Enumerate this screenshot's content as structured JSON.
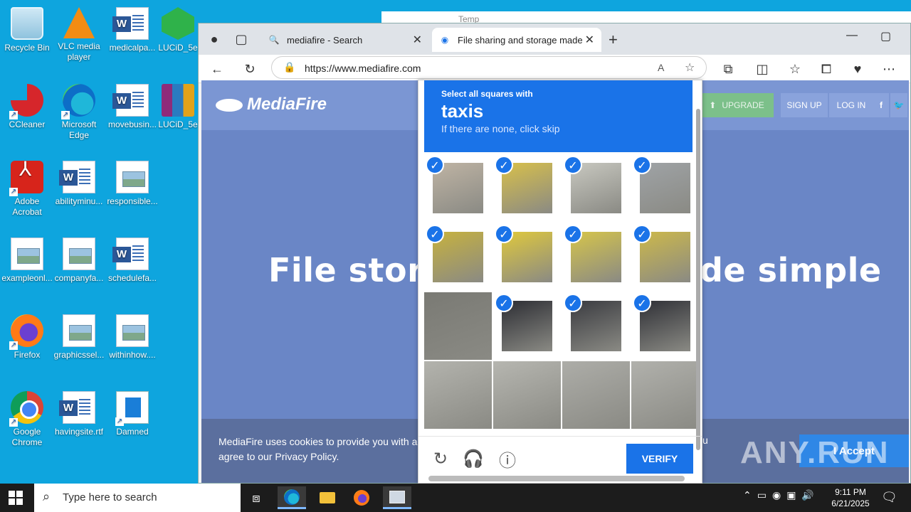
{
  "desktop": {
    "icons": [
      {
        "label": "Recycle Bin",
        "icon": "recycle-bin-icon"
      },
      {
        "label": "VLC media player",
        "icon": "vlc-icon"
      },
      {
        "label": "medicalpa...",
        "icon": "word-doc-icon"
      },
      {
        "label": "LUCiD_5e",
        "icon": "lucid-icon"
      },
      {
        "label": "CCleaner",
        "icon": "ccleaner-icon"
      },
      {
        "label": "Microsoft Edge",
        "icon": "edge-icon"
      },
      {
        "label": "movebusin...",
        "icon": "word-doc-icon"
      },
      {
        "label": "LUCiD_5e",
        "icon": "winrar-icon"
      },
      {
        "label": "Adobe Acrobat",
        "icon": "acrobat-icon"
      },
      {
        "label": "abilityminu...",
        "icon": "word-doc-icon"
      },
      {
        "label": "responsible...",
        "icon": "image-file-icon"
      },
      {
        "label": "exampleonl...",
        "icon": "image-file-icon"
      },
      {
        "label": "companyfa...",
        "icon": "image-file-icon"
      },
      {
        "label": "schedulefa...",
        "icon": "word-doc-icon"
      },
      {
        "label": "Firefox",
        "icon": "firefox-icon"
      },
      {
        "label": "graphicssel...",
        "icon": "image-file-icon"
      },
      {
        "label": "withinhow....",
        "icon": "image-file-icon"
      },
      {
        "label": "Google Chrome",
        "icon": "chrome-icon"
      },
      {
        "label": "havingsite.rtf",
        "icon": "word-doc-icon"
      },
      {
        "label": "Damned",
        "icon": "damned-icon"
      }
    ]
  },
  "background_window": {
    "title": "Temp"
  },
  "browser": {
    "tabs": [
      {
        "label": "mediafire - Search",
        "icon": "search-icon"
      },
      {
        "label": "File sharing and storage made sin",
        "icon": "mediafire-tab-icon"
      }
    ],
    "address": {
      "url": "https://www.mediafire.com"
    }
  },
  "mediafire": {
    "logo": "MediaFire",
    "upgrade": "UPGRADE",
    "signup": "SIGN UP",
    "login": "LOG IN",
    "hero_left": "File storag",
    "hero_right": "de simple",
    "cookie_line1": "MediaFire uses cookies to provide you with a p",
    "cookie_line2": "agree to our Privacy Policy.",
    "cookie_tail": "u",
    "accept": "I Accept"
  },
  "captcha": {
    "instruction": "Select all squares with",
    "target": "taxis",
    "hint": "If there are none, click skip",
    "verify": "VERIFY",
    "selected_tiles": [
      0,
      1,
      2,
      3,
      4,
      5,
      6,
      7,
      9,
      10,
      11
    ]
  },
  "watermark": "ANY.RUN",
  "taskbar": {
    "search_placeholder": "Type here to search",
    "time": "9:11 PM",
    "date": "6/21/2025"
  }
}
